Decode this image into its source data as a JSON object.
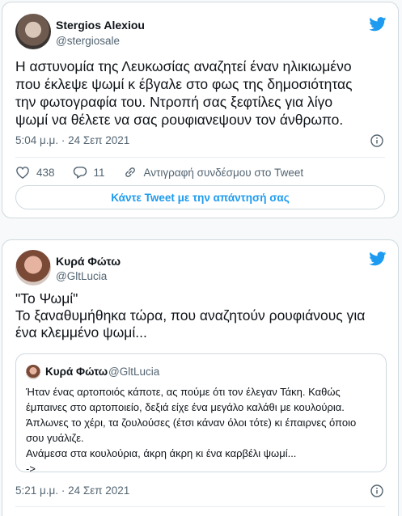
{
  "colors": {
    "accent": "#1d9bf0",
    "text": "#0f1419",
    "muted": "#536471",
    "border": "#cfd9de"
  },
  "tweet1": {
    "author_name": "Stergios Alexiou",
    "author_handle": "@stergiosale",
    "text": "Η αστυνομία της Λευκωσίας αναζητεί έναν ηλικιωμένο\nπου έκλεψε ψωμί κ έβγαλε στο φως της δημοσιότητας\nτην φωτογραφία του. Ντροπή σας ξεφτίλες για λίγο\nψωμί να θέλετε να σας ρουφιανεψουν τον άνθρωπο.",
    "timestamp": "5:04 μ.μ. · 24 Σεπ 2021",
    "likes": "438",
    "replies": "11",
    "copy_link_label": "Αντιγραφή συνδέσμου στο Tweet",
    "reply_button_label": "Κάντε Tweet με την απάντησή σας",
    "icons": [
      "twitter-bird-icon",
      "info-icon",
      "heart-icon",
      "reply-bubble-icon",
      "link-icon"
    ]
  },
  "tweet2": {
    "author_name": "Κυρά Φώτω",
    "author_handle": "@GltLucia",
    "text": "\"Το Ψωμί\"\nΤο ξαναθυμήθηκα τώρα, που αναζητούν ρουφιάνους για\nένα κλεμμένο ψωμί...",
    "timestamp": "5:21 μ.μ. · 24 Σεπ 2021",
    "quoted": {
      "author_name": "Κυρά Φώτω",
      "author_handle": "@GltLucia",
      "text": "Ήταν ένας αρτοποιός κάποτε, ας πούμε ότι τον έλεγαν Τάκη. Καθώς\nέμπαινες στο αρτοποιείο, δεξιά είχε ένα μεγάλο καλάθι με κουλούρια.\nΆπλωνες το χέρι, τα ζουλούσες (έτσι κάναν όλοι τότε) κι έπαιρνες όποιο\nσου γυάλιζε.\nΑνάμεσα στα κουλούρια, άκρη άκρη κι ένα καρβέλι ψωμί...\n->"
    }
  }
}
